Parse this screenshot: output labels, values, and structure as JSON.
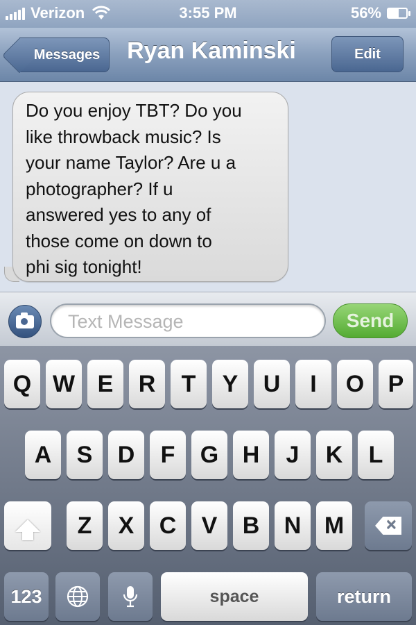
{
  "status_bar": {
    "carrier": "Verizon",
    "time": "3:55 PM",
    "battery_percent": "56%",
    "battery_level": 0.56,
    "signal_icon": "signal-bars-icon",
    "wifi_icon": "wifi-icon"
  },
  "nav": {
    "back_label": "Messages",
    "title": "Ryan Kaminski",
    "edit_label": "Edit"
  },
  "messages": [
    {
      "direction": "incoming",
      "lines": [
        "Do you enjoy TBT? Do you",
        "like throwback music? Is",
        "your name Taylor? Are u a",
        "photographer? If u",
        "answered yes to any of",
        "those come on down to",
        "phi sig tonight!"
      ]
    }
  ],
  "composer": {
    "camera_icon": "camera-icon",
    "placeholder": "Text Message",
    "send_label": "Send"
  },
  "keyboard": {
    "row1": [
      "Q",
      "W",
      "E",
      "R",
      "T",
      "Y",
      "U",
      "I",
      "O",
      "P"
    ],
    "row2": [
      "A",
      "S",
      "D",
      "F",
      "G",
      "H",
      "J",
      "K",
      "L"
    ],
    "row3": [
      "Z",
      "X",
      "C",
      "V",
      "B",
      "N",
      "M"
    ],
    "shift_icon": "shift-icon",
    "backspace_icon": "backspace-icon",
    "numbers_label": "123",
    "globe_icon": "globe-icon",
    "mic_icon": "microphone-icon",
    "space_label": "space",
    "return_label": "return"
  }
}
